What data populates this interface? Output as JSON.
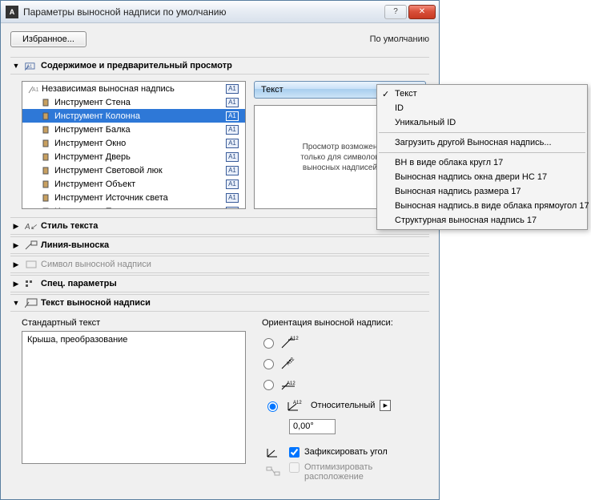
{
  "titlebar": {
    "title": "Параметры выносной надписи по умолчанию"
  },
  "toprow": {
    "fav": "Избранное...",
    "default": "По умолчанию"
  },
  "sections": {
    "content": "Содержимое и предварительный просмотр",
    "style": "Стиль текста",
    "leader": "Линия-выноска",
    "symbol": "Символ выносной надписи",
    "custom": "Спец. параметры",
    "labeltext": "Текст выносной надписи"
  },
  "tree": {
    "items": [
      {
        "label": "Независимая выносная надпись",
        "depth": 0
      },
      {
        "label": "Инструмент Стена",
        "depth": 1
      },
      {
        "label": "Инструмент Колонна",
        "depth": 1,
        "selected": true
      },
      {
        "label": "Инструмент Балка",
        "depth": 1
      },
      {
        "label": "Инструмент Окно",
        "depth": 1
      },
      {
        "label": "Инструмент Дверь",
        "depth": 1
      },
      {
        "label": "Инструмент Световой люк",
        "depth": 1
      },
      {
        "label": "Инструмент Объект",
        "depth": 1
      },
      {
        "label": "Инструмент Источник света",
        "depth": 1
      },
      {
        "label": "Инструмент Перекрытие",
        "depth": 1
      }
    ],
    "badge": "A1"
  },
  "textbtn": {
    "label": "Текст"
  },
  "preview": {
    "l1": "Просмотр возможен",
    "l2": "только для символов",
    "l3": "выносных надписей"
  },
  "std": {
    "label": "Стандартный текст",
    "value": "Крыша, преобразование"
  },
  "orient": {
    "label": "Ориентация выносной надписи:",
    "rel": "Относительный",
    "angle": "0,00°",
    "fix": "Зафиксировать угол",
    "opt_l1": "Оптимизировать",
    "opt_l2": "расположение"
  },
  "popup": {
    "items1": [
      {
        "label": "Текст",
        "checked": true
      },
      {
        "label": "ID"
      },
      {
        "label": "Уникальный ID"
      }
    ],
    "load": "Загрузить другой Выносная надпись...",
    "items2": [
      "ВН в виде облака кругл 17",
      "Выносная надпись окна двери НС 17",
      "Выносная надпись размера 17",
      "Выносная надпись.в виде облака прямоугол 17",
      "Структурная выносная надпись 17"
    ]
  }
}
